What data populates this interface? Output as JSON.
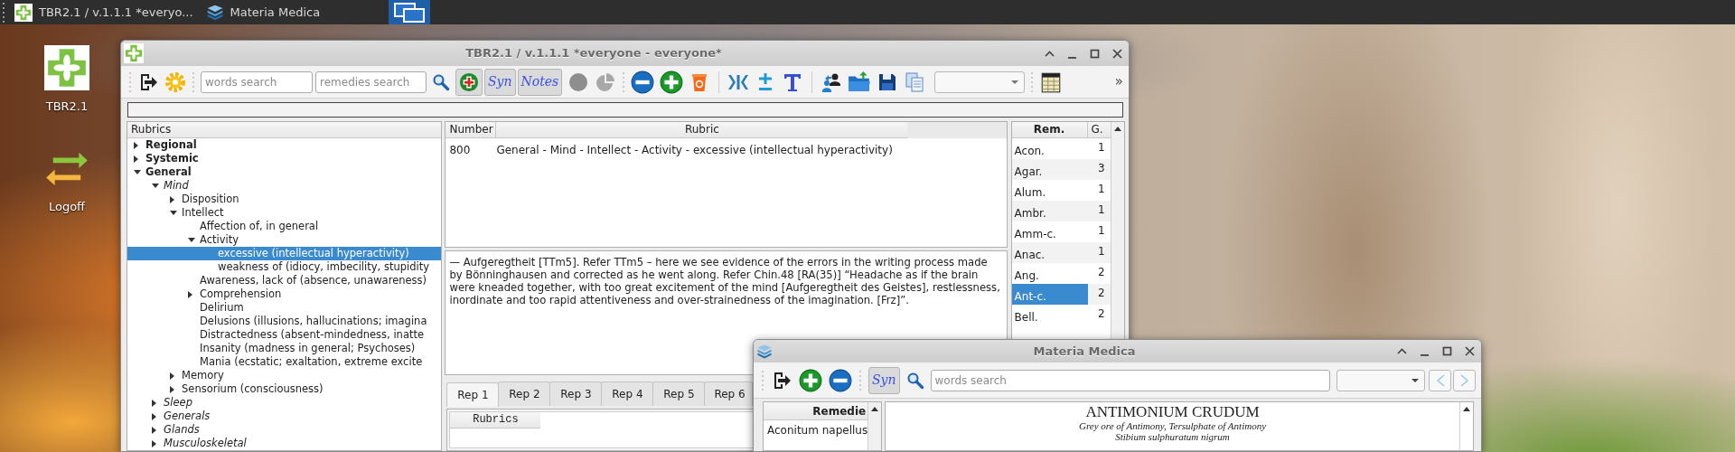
{
  "taskbar": {
    "items": [
      {
        "label": "TBR2.1 / v.1.1.1 *everyo...",
        "kind": "app"
      },
      {
        "label": "Materia Medica",
        "kind": "layers"
      }
    ]
  },
  "desktop_icons": [
    {
      "label": "TBR2.1",
      "kind": "app"
    },
    {
      "label": "Logoff",
      "kind": "logoff"
    }
  ],
  "main_window": {
    "title": "TBR2.1 / v.1.1.1 *everyone - everyone*",
    "toolbar": {
      "words_search": {
        "placeholder": "words search"
      },
      "remedies_search": {
        "placeholder": "remedies search"
      },
      "numbering_toggle": {
        "pressed": true
      },
      "syn_toggle": {
        "label": "Syn",
        "pressed": true
      },
      "notes_toggle": {
        "label": "Notes",
        "pressed": true
      },
      "overflow": "»"
    },
    "progress": {
      "level": 0
    },
    "rubrics_tree": {
      "header": "Rubrics",
      "items": [
        {
          "label": "Regional",
          "kind": "branch",
          "expanded": false,
          "selected": false
        },
        {
          "label": "Systemic",
          "kind": "branch",
          "expanded": false,
          "selected": false
        },
        {
          "label": "General",
          "kind": "branch",
          "expanded": true,
          "selected": false,
          "children": [
            {
              "label": "Mind",
              "kind": "branch",
              "expanded": true,
              "selected": false,
              "children": [
                {
                  "label": "Disposition",
                  "kind": "branch",
                  "expanded": false,
                  "selected": false
                },
                {
                  "label": "Intellect",
                  "kind": "branch",
                  "expanded": true,
                  "selected": false,
                  "children": [
                    {
                      "label": "Affection of, in general",
                      "kind": "leaf",
                      "selected": false
                    },
                    {
                      "label": "Activity",
                      "kind": "branch",
                      "expanded": true,
                      "selected": false,
                      "children": [
                        {
                          "label": "excessive (intellectual hyperactivity)",
                          "kind": "leaf",
                          "selected": true
                        },
                        {
                          "label": "weakness of (idiocy, imbecility, stupidity",
                          "kind": "leaf",
                          "selected": false
                        }
                      ]
                    },
                    {
                      "label": "Awareness, lack of (absence, unawareness)",
                      "kind": "leaf",
                      "selected": false
                    },
                    {
                      "label": "Comprehension",
                      "kind": "branch",
                      "expanded": false,
                      "selected": false
                    },
                    {
                      "label": "Delirium",
                      "kind": "leaf",
                      "selected": false
                    },
                    {
                      "label": "Delusions (illusions, hallucinations; imagina",
                      "kind": "leaf",
                      "selected": false
                    },
                    {
                      "label": "Distractedness (absent-mindedness, inatte",
                      "kind": "leaf",
                      "selected": false
                    },
                    {
                      "label": "Insanity (madness in general; Psychoses)",
                      "kind": "leaf",
                      "selected": false
                    },
                    {
                      "label": "Mania (ecstatic; exaltation, extreme excite",
                      "kind": "leaf",
                      "selected": false
                    }
                  ]
                },
                {
                  "label": "Memory",
                  "kind": "branch",
                  "expanded": false,
                  "selected": false
                },
                {
                  "label": "Sensorium (consciousness)",
                  "kind": "branch",
                  "expanded": false,
                  "selected": false
                }
              ]
            },
            {
              "label": "Sleep",
              "kind": "branch",
              "expanded": false,
              "selected": false
            },
            {
              "label": "Generals",
              "kind": "branch",
              "expanded": false,
              "selected": false
            },
            {
              "label": "Glands",
              "kind": "branch",
              "expanded": false,
              "selected": false
            },
            {
              "label": "Musculoskeletal",
              "kind": "branch",
              "expanded": false,
              "selected": false
            }
          ]
        }
      ]
    },
    "rubric_table": {
      "columns": [
        "Number",
        "Rubric"
      ],
      "rows": [
        {
          "number": "800",
          "rubric": "General - Mind - Intellect - Activity - excessive (intellectual hyperactivity)"
        }
      ]
    },
    "note": "— Aufgeregtheit [TTm5]. Refer TTm5 – here we see evidence of the errors in the writing process made by Bönninghausen and corrected as he went along. Refer Chin.48 [RA(35)] “Headache as if the brain were kneaded together, with too great excitement of the mind [Aufgeregtheit des Geistes], restlessness, inordinate and too rapid attentiveness and over-strainedness of the imagination. [Frz]”.",
    "rep_tabs": [
      {
        "label": "Rep 1",
        "selected": true
      },
      {
        "label": "Rep 2",
        "selected": false
      },
      {
        "label": "Rep 3",
        "selected": false
      },
      {
        "label": "Rep 4",
        "selected": false
      },
      {
        "label": "Rep 5",
        "selected": false
      },
      {
        "label": "Rep 6",
        "selected": false
      }
    ],
    "rep_table": {
      "columns": [
        "Rubrics"
      ]
    },
    "remedies": {
      "columns": [
        "Rem.",
        "G."
      ],
      "rows": [
        {
          "rem": "Acon.",
          "grade": "1",
          "selected": false
        },
        {
          "rem": "Agar.",
          "grade": "3",
          "selected": false
        },
        {
          "rem": "Alum.",
          "grade": "1",
          "selected": false
        },
        {
          "rem": "Ambr.",
          "grade": "1",
          "selected": false
        },
        {
          "rem": "Amm-c.",
          "grade": "1",
          "selected": false
        },
        {
          "rem": "Anac.",
          "grade": "1",
          "selected": false
        },
        {
          "rem": "Ang.",
          "grade": "2",
          "selected": false
        },
        {
          "rem": "Ant-c.",
          "grade": "2",
          "selected": true
        },
        {
          "rem": "Bell.",
          "grade": "2",
          "selected": false
        }
      ]
    }
  },
  "materia_window": {
    "title": "Materia Medica",
    "toolbar": {
      "syn_toggle": {
        "label": "Syn",
        "pressed": true
      },
      "words_search": {
        "placeholder": "words search"
      }
    },
    "remedies": {
      "header": "Remedie",
      "items": [
        "Aconitum napellus"
      ]
    },
    "document": {
      "title": "ANTIMONIUM CRUDUM",
      "subtitles": [
        "Grey ore of Antimony, Tersulphate of Antimony",
        "Stibium sulphuratum nigrum"
      ]
    }
  }
}
